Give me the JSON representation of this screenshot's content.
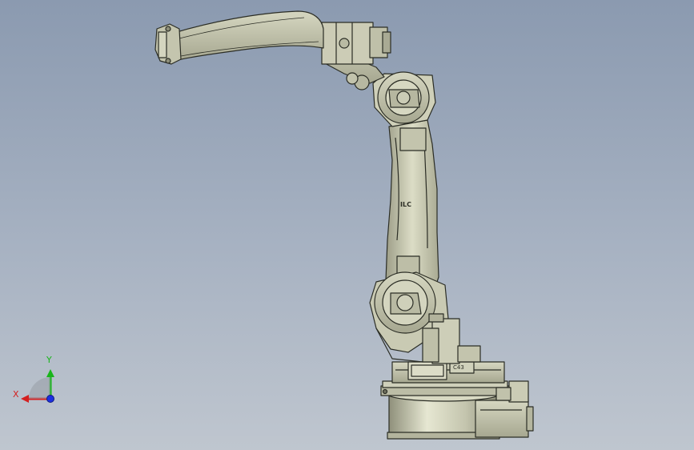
{
  "viewport": {
    "background_top": "#8b9ab0",
    "background_bottom": "#bfc6cf",
    "model_fill": "#c8c9b2",
    "model_stroke": "#2b2d25"
  },
  "model": {
    "arm_logo_text": "ILC",
    "base_plate_text": "C43"
  },
  "triad": {
    "x_label": "X",
    "y_label": "Y",
    "x_color": "#d42020",
    "y_color": "#19b51b",
    "z_color": "#1c2fe0"
  }
}
